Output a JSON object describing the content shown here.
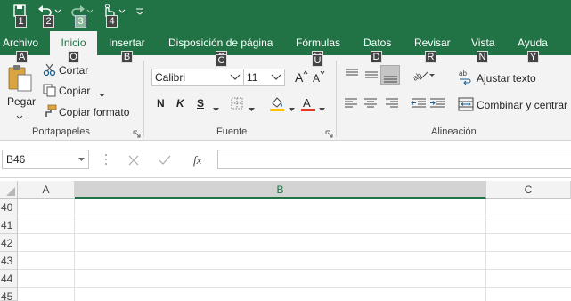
{
  "qat": {
    "keytips": [
      "1",
      "2",
      "3",
      "4"
    ]
  },
  "tabs": [
    {
      "label": "Archivo",
      "keytip": "A"
    },
    {
      "label": "Inicio",
      "keytip": "O"
    },
    {
      "label": "Insertar",
      "keytip": "B"
    },
    {
      "label": "Disposición de página",
      "keytip": "C"
    },
    {
      "label": "Fórmulas",
      "keytip": "U"
    },
    {
      "label": "Datos",
      "keytip": "D"
    },
    {
      "label": "Revisar",
      "keytip": "R"
    },
    {
      "label": "Vista",
      "keytip": "N"
    },
    {
      "label": "Ayuda",
      "keytip": "Y"
    }
  ],
  "clipboard": {
    "paste_label": "Pegar",
    "cut_label": "Cortar",
    "copy_label": "Copiar",
    "format_painter_label": "Copiar formato",
    "group_label": "Portapapeles"
  },
  "font": {
    "font_name": "Calibri",
    "font_size": "11",
    "bold": "N",
    "italic": "K",
    "underline": "S",
    "group_label": "Fuente"
  },
  "alignment": {
    "wrap_text_label": "Ajustar texto",
    "merge_center_label": "Combinar y centrar",
    "group_label": "Alineación"
  },
  "formula_bar": {
    "name_box": "B46",
    "fx_label": "fx",
    "formula": ""
  },
  "grid": {
    "columns": [
      "A",
      "B",
      "C"
    ],
    "rows": [
      "40",
      "41",
      "42",
      "43",
      "44",
      "45"
    ],
    "selected_column": "B"
  },
  "colors": {
    "brand": "#217346",
    "ribbon": "#f3f3f3"
  }
}
